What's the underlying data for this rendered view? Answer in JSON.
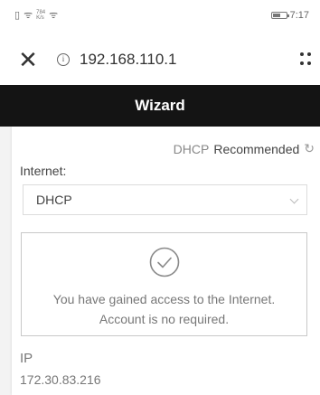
{
  "status_bar": {
    "left_icons": [
      "sim-card-icon",
      "wifi-calling-icon",
      "signal-icon",
      "wifi-icon"
    ],
    "tiny_text": "784\nK/s",
    "time": "7:17"
  },
  "address_bar": {
    "url": "192.168.110.1",
    "close_icon": "close-icon",
    "info_icon": "info-icon",
    "menu_icon": "menu-icon"
  },
  "header": {
    "title": "Wizard"
  },
  "card": {
    "mode_hint": "DHCP",
    "recommended": "Recommended",
    "internet_label": "Internet:",
    "select_value": "DHCP",
    "status_line1": "You have gained access to the Internet.",
    "status_line2": "Account is no required.",
    "ip_label": "IP",
    "ip_value": "172.30.83.216"
  }
}
